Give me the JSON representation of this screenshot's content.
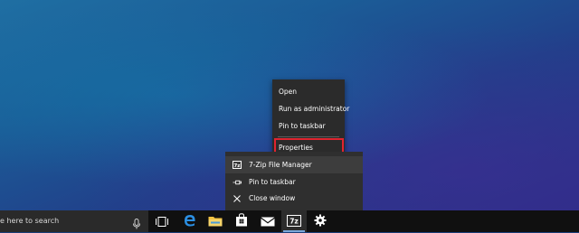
{
  "context_menu": {
    "items": [
      {
        "label": "Open"
      },
      {
        "label": "Run as administrator"
      },
      {
        "label": "Pin to taskbar"
      },
      {
        "label": "Properties"
      }
    ]
  },
  "jump_list": {
    "items": [
      {
        "label": "7-Zip File Manager",
        "icon": "7zip-icon"
      },
      {
        "label": "Pin to taskbar",
        "icon": "pin-icon"
      },
      {
        "label": "Close window",
        "icon": "close-icon"
      }
    ]
  },
  "taskbar": {
    "search_text": "e here to search",
    "buttons": [
      {
        "name": "task-view",
        "icon": "task-view-icon"
      },
      {
        "name": "edge",
        "icon": "edge-icon"
      },
      {
        "name": "file-explorer",
        "icon": "folder-icon"
      },
      {
        "name": "store",
        "icon": "store-icon"
      },
      {
        "name": "mail",
        "icon": "mail-icon"
      },
      {
        "name": "7zip",
        "icon": "7zip-icon",
        "active": true
      },
      {
        "name": "settings",
        "icon": "gear-icon"
      }
    ]
  },
  "colors": {
    "highlight_border": "#e0242f",
    "taskbar_bg": "#101010",
    "menu_bg": "#2b2b2b"
  }
}
